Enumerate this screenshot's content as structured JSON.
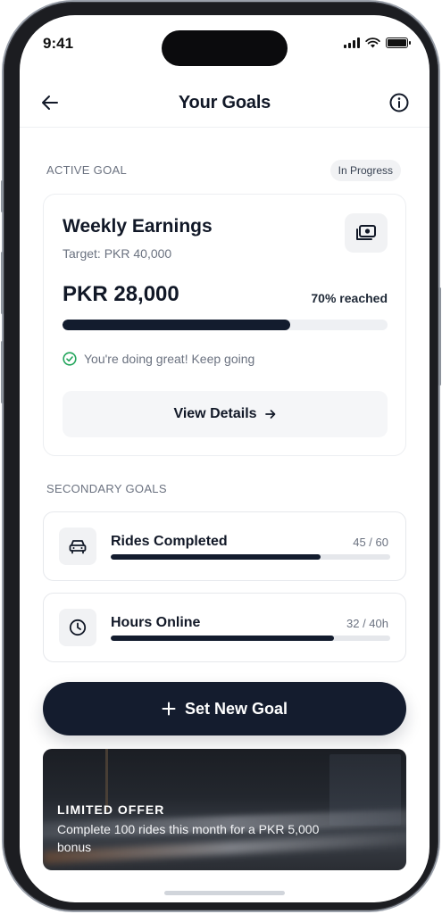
{
  "status_bar": {
    "time": "9:41"
  },
  "header": {
    "title": "Your Goals"
  },
  "active_goal": {
    "section_label": "ACTIVE GOAL",
    "status": "In Progress",
    "name": "Weekly Earnings",
    "target": "Target: PKR 40,000",
    "amount": "PKR 28,000",
    "reached_label": "70% reached",
    "progress_fraction": 0.7,
    "message": "You're doing great! Keep going",
    "view_details_label": "View Details"
  },
  "secondary": {
    "section_label": "SECONDARY GOALS",
    "items": [
      {
        "icon": "car-icon",
        "name": "Rides Completed",
        "count": "45 / 60",
        "progress_fraction": 0.75
      },
      {
        "icon": "clock-icon",
        "name": "Hours Online",
        "count": "32 / 40h",
        "progress_fraction": 0.8
      }
    ]
  },
  "cta": {
    "label": "Set New Goal"
  },
  "banner": {
    "tag": "LIMITED OFFER",
    "description": "Complete 100 rides this month for a PKR 5,000 bonus"
  },
  "colors": {
    "primary": "#131c2e",
    "muted": "#6b7280",
    "success": "#22a55b"
  }
}
